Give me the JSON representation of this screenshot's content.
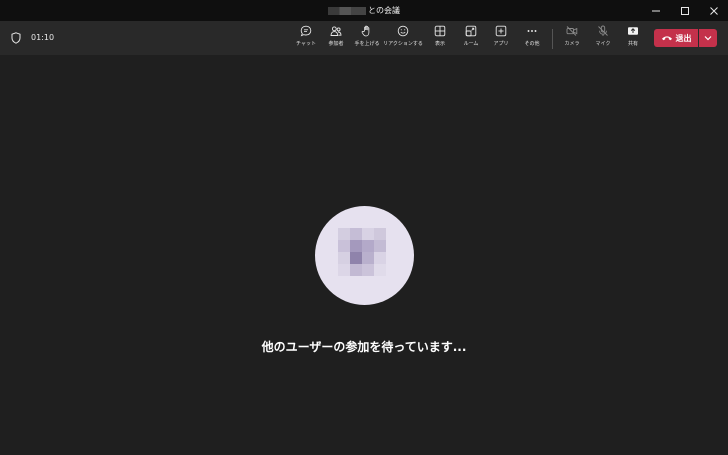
{
  "window": {
    "title_suffix": "との会議",
    "controls": {
      "minimize": "minimize-icon",
      "maximize": "maximize-icon",
      "close": "close-icon"
    }
  },
  "toolbar": {
    "timer": "01:10",
    "items": [
      {
        "label": "チャット",
        "icon": "chat-icon"
      },
      {
        "label": "参加者",
        "icon": "people-icon"
      },
      {
        "label": "手を上げる",
        "icon": "raise-hand-icon"
      },
      {
        "label": "リアクションする",
        "icon": "reaction-icon"
      },
      {
        "label": "表示",
        "icon": "view-grid-icon"
      },
      {
        "label": "ルーム",
        "icon": "rooms-icon"
      },
      {
        "label": "アプリ",
        "icon": "apps-icon"
      },
      {
        "label": "その他",
        "icon": "more-icon"
      },
      {
        "label": "カメラ",
        "icon": "camera-off-icon"
      },
      {
        "label": "マイク",
        "icon": "mic-off-icon"
      },
      {
        "label": "共有",
        "icon": "share-icon"
      }
    ],
    "leave": {
      "label": "退出",
      "color": "#c4314b"
    }
  },
  "main": {
    "waiting_text": "他のユーザーの参加を待っています..."
  },
  "colors": {
    "background": "#1f1f1f",
    "toolbar": "#292929",
    "titlebar": "#0f0f0f",
    "avatar_bg": "#e6e1ef"
  }
}
